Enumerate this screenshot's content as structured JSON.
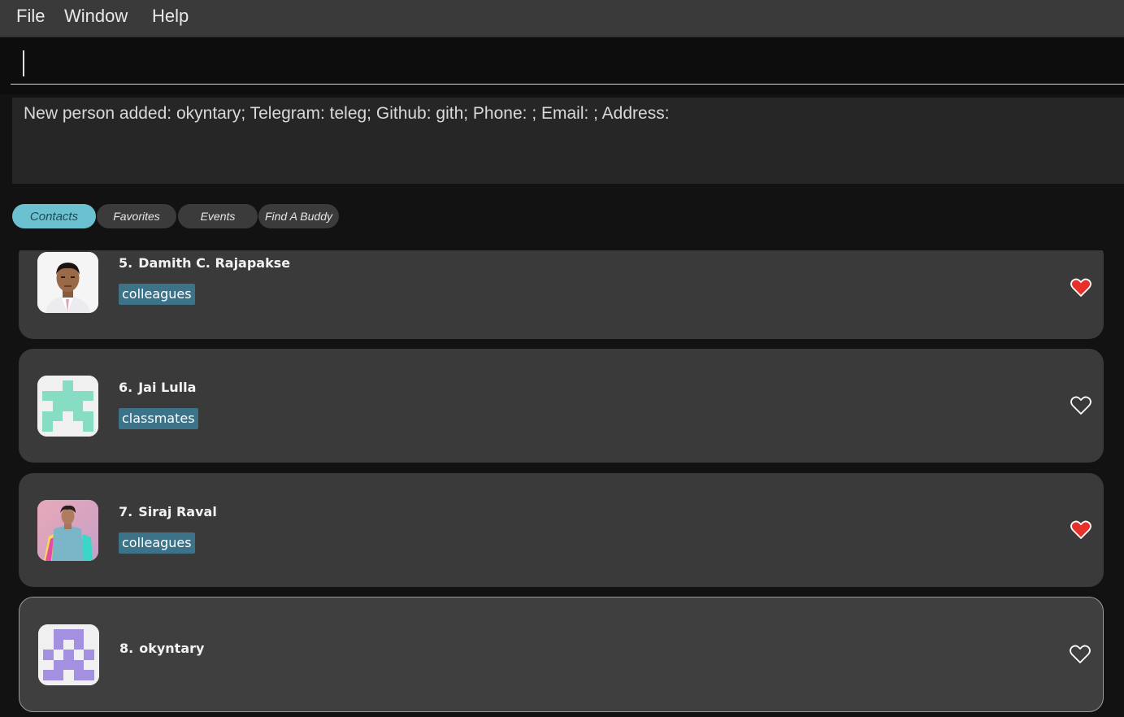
{
  "menu": {
    "file": "File",
    "window": "Window",
    "help": "Help"
  },
  "command": {
    "value": ""
  },
  "result": {
    "message": "New person added: okyntary; Telegram: teleg; Github: gith; Phone: ; Email: ; Address:"
  },
  "tabs": [
    {
      "label": "Contacts",
      "active": true
    },
    {
      "label": "Favorites",
      "active": false
    },
    {
      "label": "Events",
      "active": false
    },
    {
      "label": "Find A Buddy",
      "active": false
    }
  ],
  "contacts": [
    {
      "index": "5.",
      "name": "Damith C. Rajapakse",
      "tag": "colleagues",
      "favorite": true,
      "avatar": "photo-man-icon"
    },
    {
      "index": "6.",
      "name": "Jai Lulla",
      "tag": "classmates",
      "favorite": false,
      "avatar": "identicon-green-icon"
    },
    {
      "index": "7.",
      "name": "Siraj Raval",
      "tag": "colleagues",
      "favorite": true,
      "avatar": "photo-colorful-icon"
    },
    {
      "index": "8.",
      "name": "okyntary",
      "tag": "",
      "favorite": false,
      "avatar": "identicon-purple-icon"
    }
  ],
  "colors": {
    "accent": "#6cc1d1",
    "tag": "#3d7388",
    "heart_filled": "#e8302a",
    "card": "#3a3a3a"
  }
}
